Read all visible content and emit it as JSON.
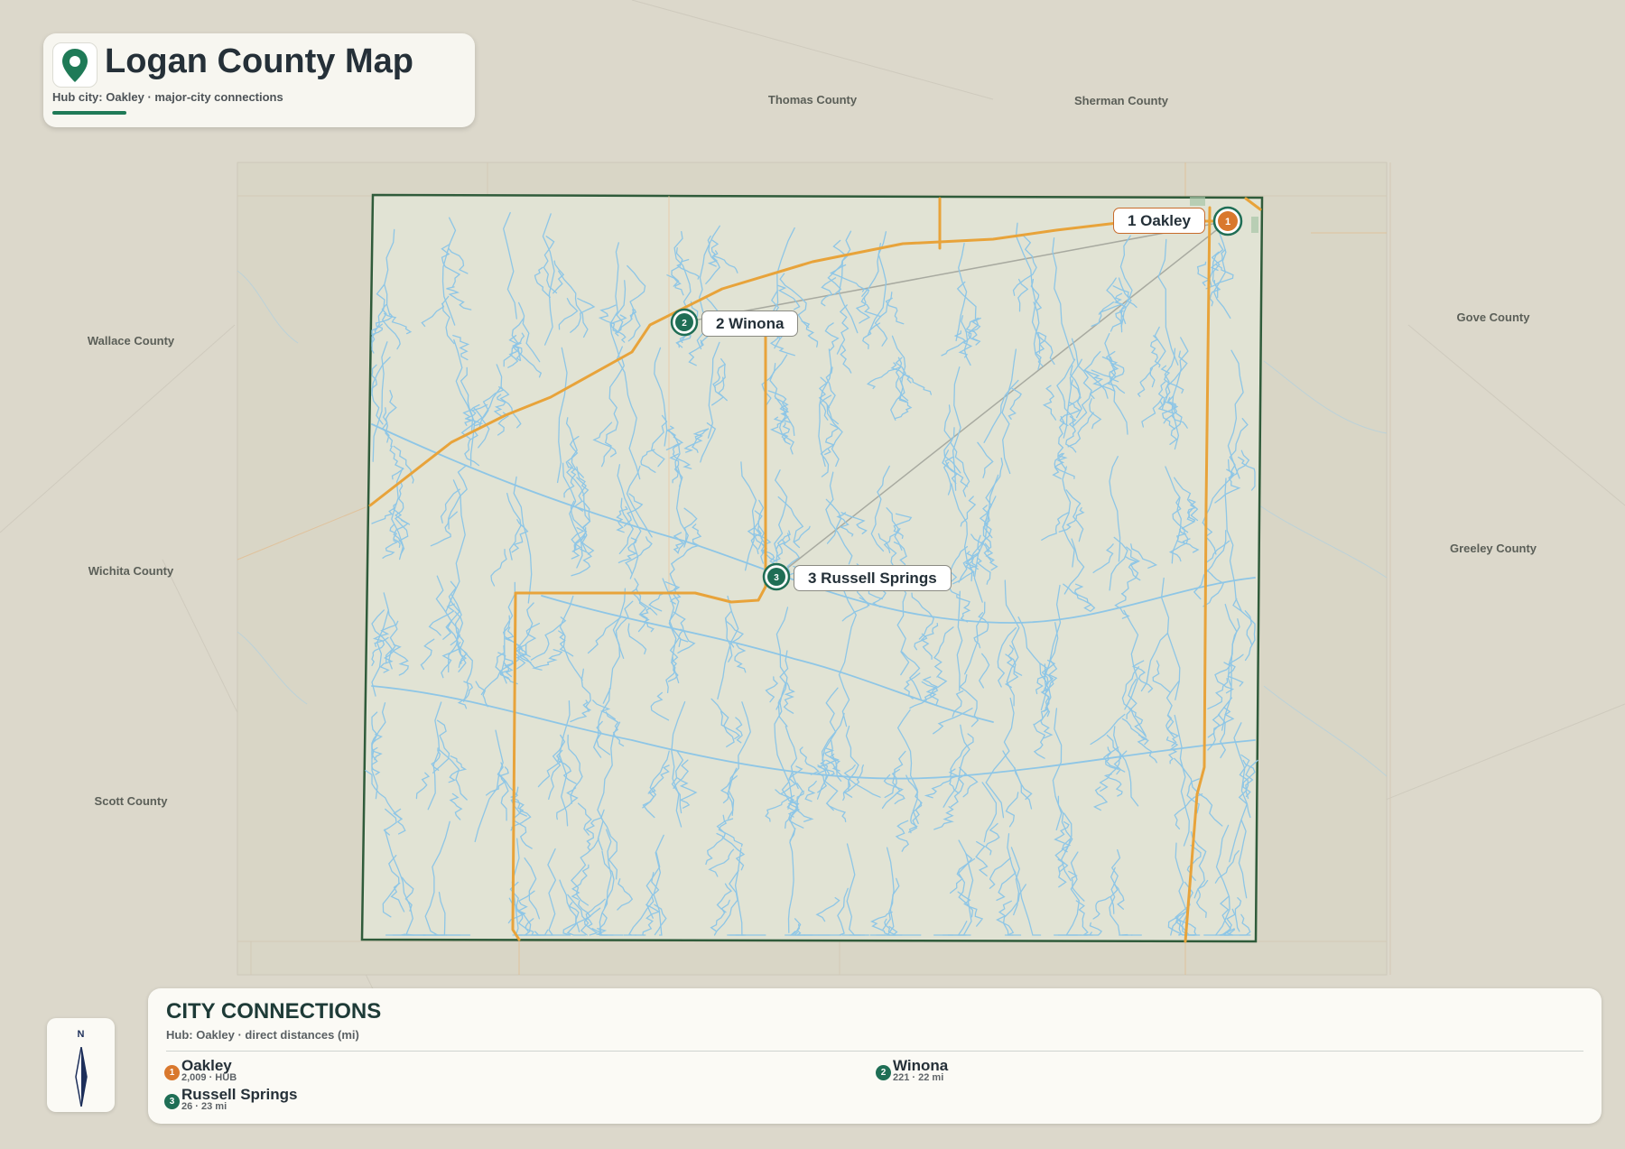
{
  "header": {
    "title": "Logan County Map",
    "subtitle": "Hub city: Oakley · major-city connections",
    "icon": "map-pin-icon"
  },
  "neighbors": [
    {
      "key": "thomas",
      "name": "Thomas County"
    },
    {
      "key": "sherman",
      "name": "Sherman County"
    },
    {
      "key": "gove",
      "name": "Gove County"
    },
    {
      "key": "wallace",
      "name": "Wallace County"
    },
    {
      "key": "greeley",
      "name": "Greeley County"
    },
    {
      "key": "wichita",
      "name": "Wichita County"
    },
    {
      "key": "scott",
      "name": "Scott County"
    }
  ],
  "cities": [
    {
      "num": "1",
      "name": "Oakley",
      "label": "1 Oakley",
      "hub": true
    },
    {
      "num": "2",
      "name": "Winona",
      "label": "2 Winona",
      "hub": false
    },
    {
      "num": "3",
      "name": "Russell Springs",
      "label": "3 Russell Springs",
      "hub": false
    }
  ],
  "compass": {
    "label": "N",
    "icon": "north-arrow-icon"
  },
  "panel": {
    "title": "CITY CONNECTIONS",
    "subtitle": "Hub: Oakley · direct distances (mi)",
    "entries": [
      {
        "num": "1",
        "name": "Oakley",
        "detail": "2,009 · HUB"
      },
      {
        "num": "2",
        "name": "Winona",
        "detail": "221 · 22 mi"
      },
      {
        "num": "3",
        "name": "Russell Springs",
        "detail": "26 · 23 mi"
      }
    ]
  },
  "colors": {
    "background": "#dcd8cb",
    "county_fill": "#e1e3d4",
    "county_border": "#2f5b3a",
    "road": "#e8a33a",
    "water": "#8ec6e6",
    "hub": "#d9782d",
    "city": "#1f6e55",
    "accent": "#1f7a57"
  }
}
